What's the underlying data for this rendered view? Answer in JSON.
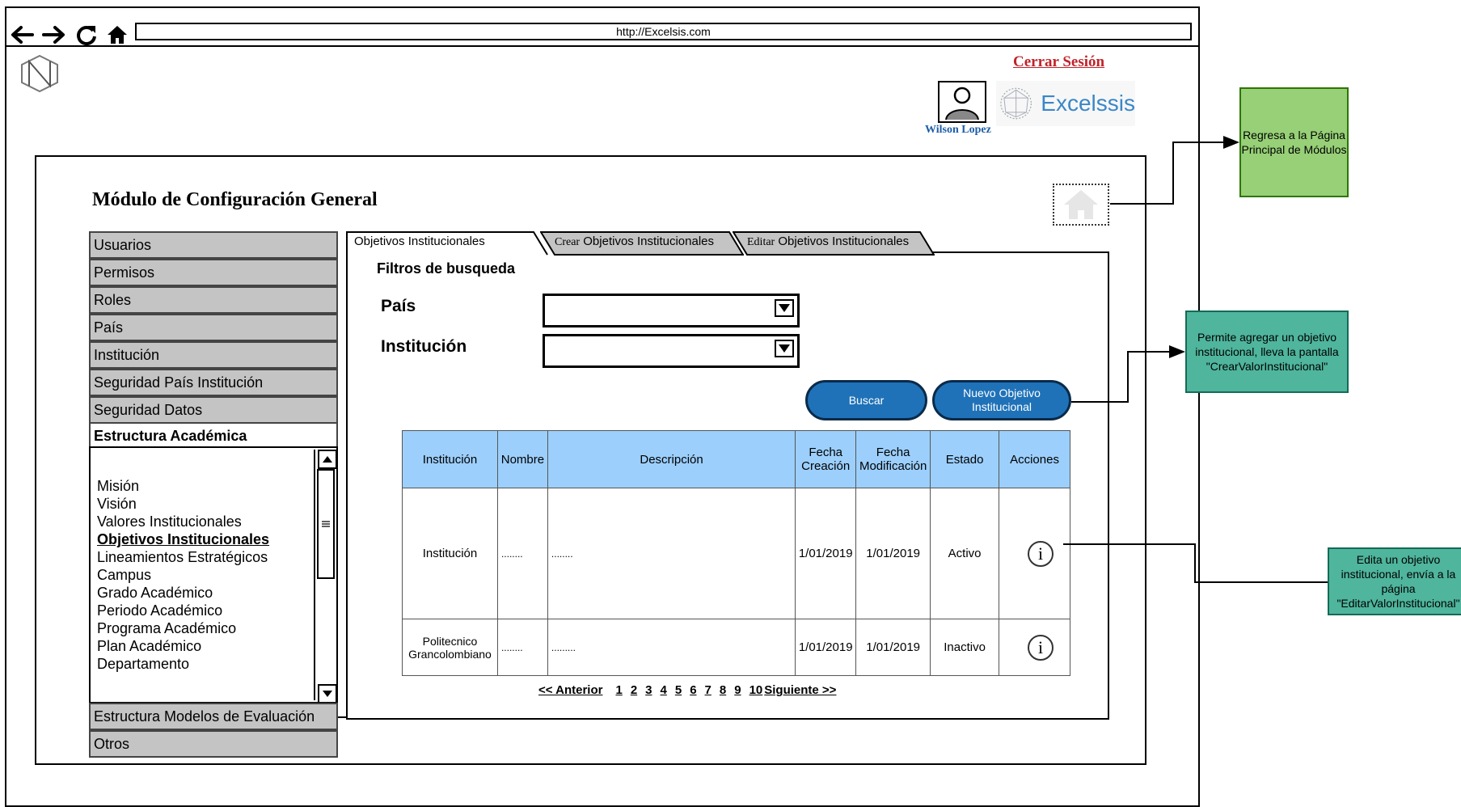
{
  "browser": {
    "url": "http://Excelsis.com",
    "nav_icons": [
      "back-arrow-icon",
      "forward-arrow-icon",
      "refresh-icon",
      "home-icon"
    ]
  },
  "header": {
    "logout_label": "Cerrar Sesión",
    "user_name": "Wilson Lopez",
    "brand_name": "Excelssis"
  },
  "module": {
    "title": "Módulo de Configuración General"
  },
  "sidebar": {
    "items_top": [
      {
        "label": "Usuarios"
      },
      {
        "label": "Permisos"
      },
      {
        "label": "Roles"
      },
      {
        "label": "País"
      },
      {
        "label": "Institución"
      },
      {
        "label": "Seguridad País Institución"
      },
      {
        "label": "Seguridad Datos"
      },
      {
        "label": "Estructura Académica"
      }
    ],
    "submenu": [
      {
        "label": "Misión"
      },
      {
        "label": "Visión"
      },
      {
        "label": "Valores Institucionales"
      },
      {
        "label": "Objetivos Institucionales"
      },
      {
        "label": "Lineamientos Estratégicos"
      },
      {
        "label": "Campus"
      },
      {
        "label": "Grado Académico"
      },
      {
        "label": "Periodo Académico"
      },
      {
        "label": "Programa Académico"
      },
      {
        "label": "Plan Académico"
      },
      {
        "label": "Departamento"
      }
    ],
    "items_bottom": [
      {
        "label": "Estructura Modelos de Evaluación"
      },
      {
        "label": "Otros"
      }
    ]
  },
  "tabs": [
    {
      "prefix": "",
      "label": "Objetivos Institucionales"
    },
    {
      "prefix": "Crear",
      "label": " Objetivos Institucionales"
    },
    {
      "prefix": "Editar",
      "label": " Objetivos Institucionales"
    }
  ],
  "filters": {
    "title": "Filtros de busqueda",
    "country_label": "País",
    "country_value": "",
    "institution_label": "Institución",
    "institution_value": ""
  },
  "buttons": {
    "search": "Buscar",
    "new_objective": "Nuevo Objetivo Institucional"
  },
  "table": {
    "headers": {
      "institucion": "Institución",
      "nombre": "Nombre",
      "descripcion": "Descripción",
      "fecha_creacion": "Fecha Creación",
      "fecha_modificacion": "Fecha Modificación",
      "estado": "Estado",
      "acciones": "Acciones"
    },
    "rows": [
      {
        "institucion": "Institución",
        "nombre": "........",
        "descripcion": "........",
        "fecha_creacion": "1/01/2019",
        "fecha_modificacion": "1/01/2019",
        "estado": "Activo",
        "accion": "i"
      },
      {
        "institucion": "Politecnico Grancolombiano",
        "nombre": "........",
        "descripcion": ".........",
        "fecha_creacion": "1/01/2019",
        "fecha_modificacion": "1/01/2019",
        "estado": "Inactivo",
        "accion": "i"
      }
    ]
  },
  "pagination": {
    "prev": "<< Anterior",
    "pages": [
      "1",
      "2",
      "3",
      "4",
      "5",
      "6",
      "7",
      "8",
      "9",
      "10"
    ],
    "next": "Siguiente >>"
  },
  "annotations": {
    "home": "Regresa a la Página Principal de Módulos",
    "new": "Permite agregar un objetivo institucional, lleva la pantalla \"CrearValorInstitucional\"",
    "edit": "Edita un objetivo institucional, envía  a la página \"EditarValorInstitucional\""
  }
}
